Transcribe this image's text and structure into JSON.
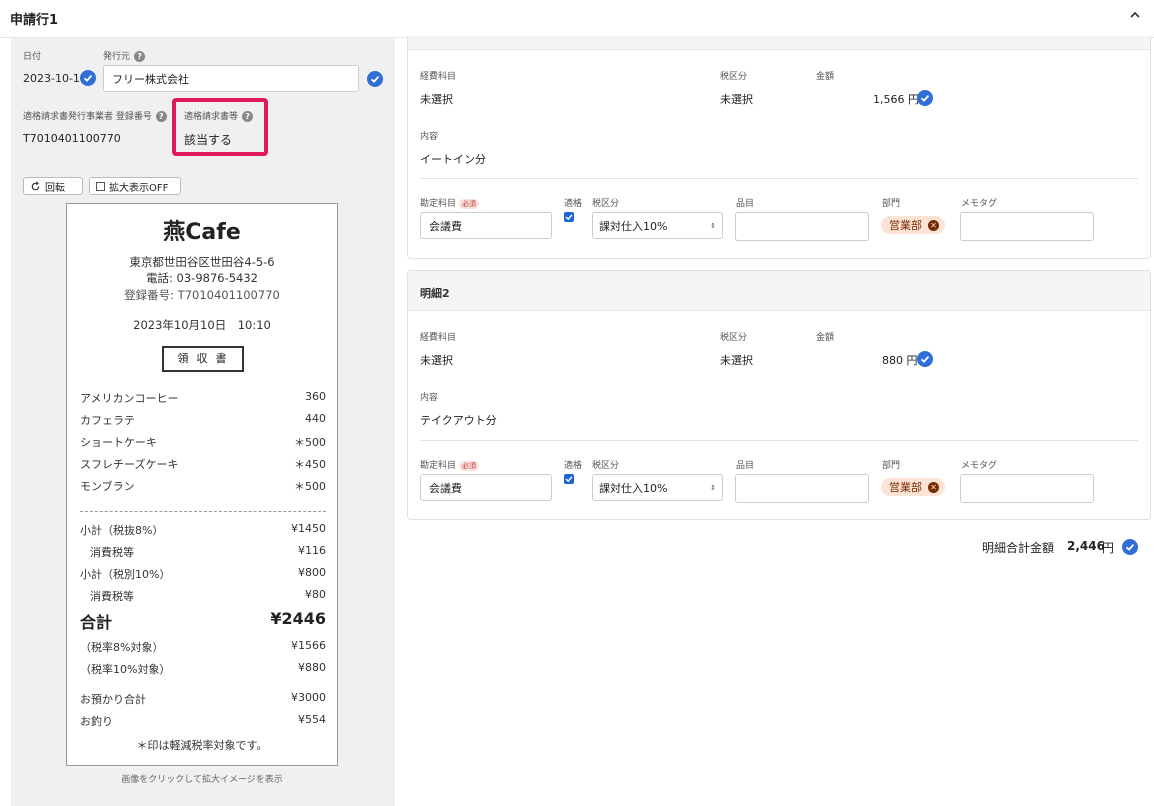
{
  "header": {
    "title": "申請行1"
  },
  "invoice": {
    "date_label": "日付",
    "date_value": "2023-10-10",
    "issuer_label": "発行元",
    "issuer_value": "フリー株式会社",
    "reg_label": "適格請求書発行事業者 登録番号",
    "reg_value": "T7010401100770",
    "qualified_label": "適格請求書等",
    "qualified_value": "該当する",
    "rotate_label": "回転",
    "zoom_label": "拡大表示OFF"
  },
  "receipt": {
    "store": "燕Cafe",
    "address": "東京都世田谷区世田谷4-5-6",
    "phone": "電話: 03-9876-5432",
    "reg": "登録番号: T7010401100770",
    "datetime": "2023年10月10日　10:10",
    "doc_title": "領収書",
    "items": [
      {
        "name": "アメリカンコーヒー",
        "price": "360"
      },
      {
        "name": "カフェラテ",
        "price": "440"
      },
      {
        "name": "ショートケーキ",
        "price": "＊500"
      },
      {
        "name": "スフレチーズケーキ",
        "price": "＊450"
      },
      {
        "name": "モンブラン",
        "price": "＊500"
      }
    ],
    "subtotal8_label": "小計（税抜8%）",
    "subtotal8": "¥1450",
    "tax8_label": "消費税等",
    "tax8": "¥116",
    "subtotal10_label": "小計（税別10%）",
    "subtotal10": "¥800",
    "tax10_label": "消費税等",
    "tax10": "¥80",
    "total_label": "合計",
    "total": "¥2446",
    "target8_label": "（税率8%対象）",
    "target8": "¥1566",
    "target10_label": "（税率10%対象）",
    "target10": "¥880",
    "paid_label": "お預かり合計",
    "paid": "¥3000",
    "change_label": "お釣り",
    "change": "¥554",
    "note": "＊印は軽減税率対象です。",
    "caption": "画像をクリックして拡大イメージを表示"
  },
  "labels": {
    "expense": "経費科目",
    "tax_cat": "税区分",
    "amount": "金額",
    "content": "内容",
    "account": "勘定科目",
    "required": "必須",
    "qualified": "適格",
    "item": "品目",
    "dept": "部門",
    "memo": "メモタグ",
    "yen": "円"
  },
  "details": [
    {
      "title": "",
      "expense": "未選択",
      "tax_cat": "未選択",
      "amount": "1,566",
      "content": "イートイン分",
      "account": "会議費",
      "tax_select": "課対仕入10%",
      "dept": "営業部"
    },
    {
      "title": "明細2",
      "expense": "未選択",
      "tax_cat": "未選択",
      "amount": "880",
      "content": "テイクアウト分",
      "account": "会議費",
      "tax_select": "課対仕入10%",
      "dept": "営業部"
    }
  ],
  "total": {
    "label": "明細合計金額",
    "value": "2,446",
    "unit": "円"
  },
  "colors": {
    "accent": "#2f6fd6",
    "highlight": "#e0195f",
    "tag_bg": "#fbe3d6"
  }
}
